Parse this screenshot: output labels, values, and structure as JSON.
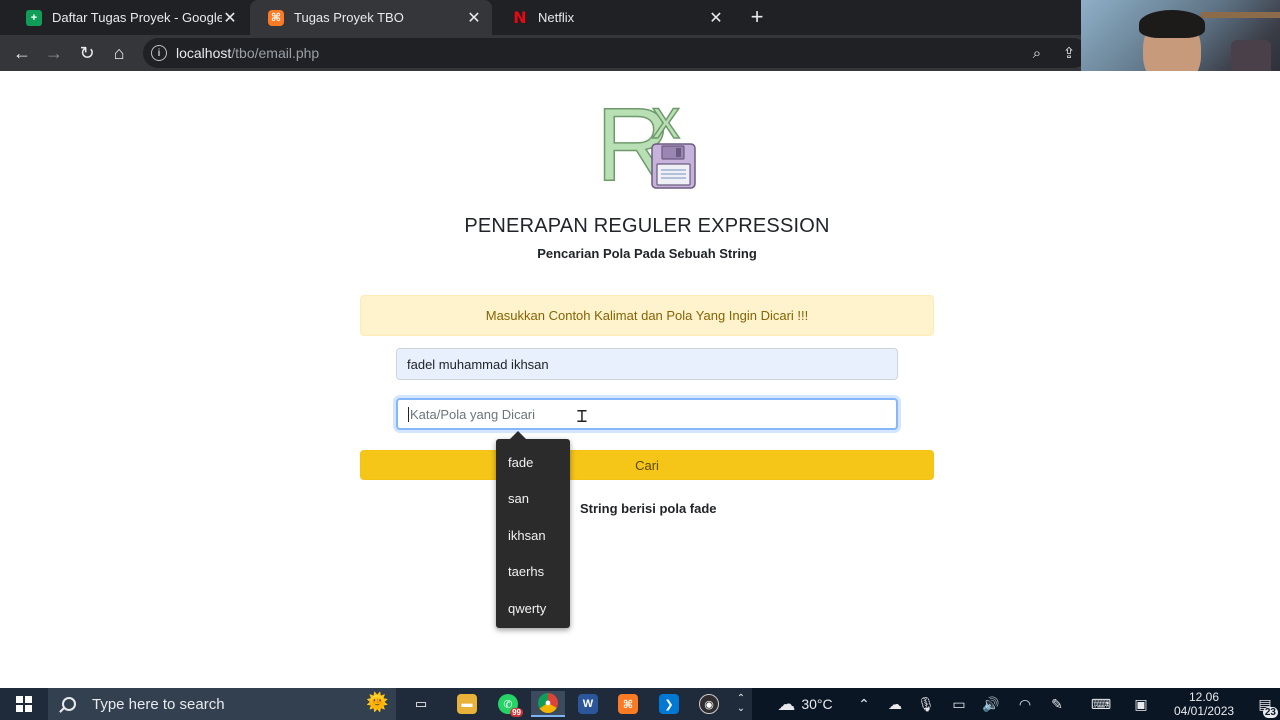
{
  "browser": {
    "tabs": [
      {
        "title": "Daftar Tugas Proyek - Google Sp",
        "icon": "sheets-icon",
        "active": false
      },
      {
        "title": "Tugas Proyek TBO",
        "icon": "xampp-icon",
        "active": true
      },
      {
        "title": "Netflix",
        "icon": "netflix-icon",
        "active": false
      }
    ],
    "new_tab": "+",
    "url_host": "localhost",
    "url_path": "/tbo/email.php"
  },
  "page": {
    "logo_letters": "Rx",
    "title": "PENERAPAN REGULER EXPRESSION",
    "subtitle": "Pencarian Pola Pada Sebuah String",
    "alert": "Masukkan Contoh Kalimat dan Pola Yang Ingin Dicari !!!",
    "sentence_value": "fadel muhammad ikhsan",
    "pattern_placeholder": "Kata/Pola yang Dicari",
    "submit_label": "Cari",
    "result": "String berisi pola fade",
    "suggestions": [
      "fade",
      "san",
      "ikhsan",
      "taerhs",
      "qwerty"
    ]
  },
  "taskbar": {
    "search_placeholder": "Type here to search",
    "whatsapp_badge": "99",
    "weather": "30°C",
    "time": "12.06",
    "date": "04/01/2023",
    "notifications": "23"
  },
  "colors": {
    "alert_bg": "#fff3cd",
    "button_yellow": "#f5c518",
    "logo_green": "#b9e0b5",
    "logo_purple": "#c7b2db"
  }
}
